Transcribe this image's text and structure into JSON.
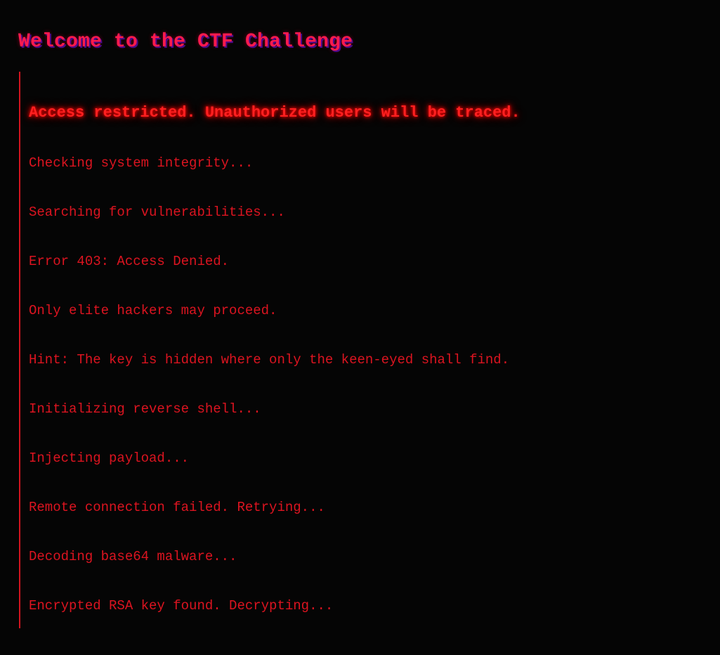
{
  "header": {
    "title": "Welcome to the CTF Challenge"
  },
  "terminal": {
    "warning": "Access restricted. Unauthorized users will be traced.",
    "lines": [
      "Checking system integrity...",
      "Searching for vulnerabilities...",
      "Error 403: Access Denied.",
      "Only elite hackers may proceed.",
      "Hint: The key is hidden where only the keen-eyed shall find.",
      "Initializing reverse shell...",
      "Injecting payload...",
      "Remote connection failed. Retrying...",
      "Decoding base64 malware...",
      "Encrypted RSA key found. Decrypting..."
    ]
  },
  "colors": {
    "background": "#050505",
    "accent": "#ff1a4e",
    "text": "#dc1420",
    "border": "#d2141f"
  }
}
